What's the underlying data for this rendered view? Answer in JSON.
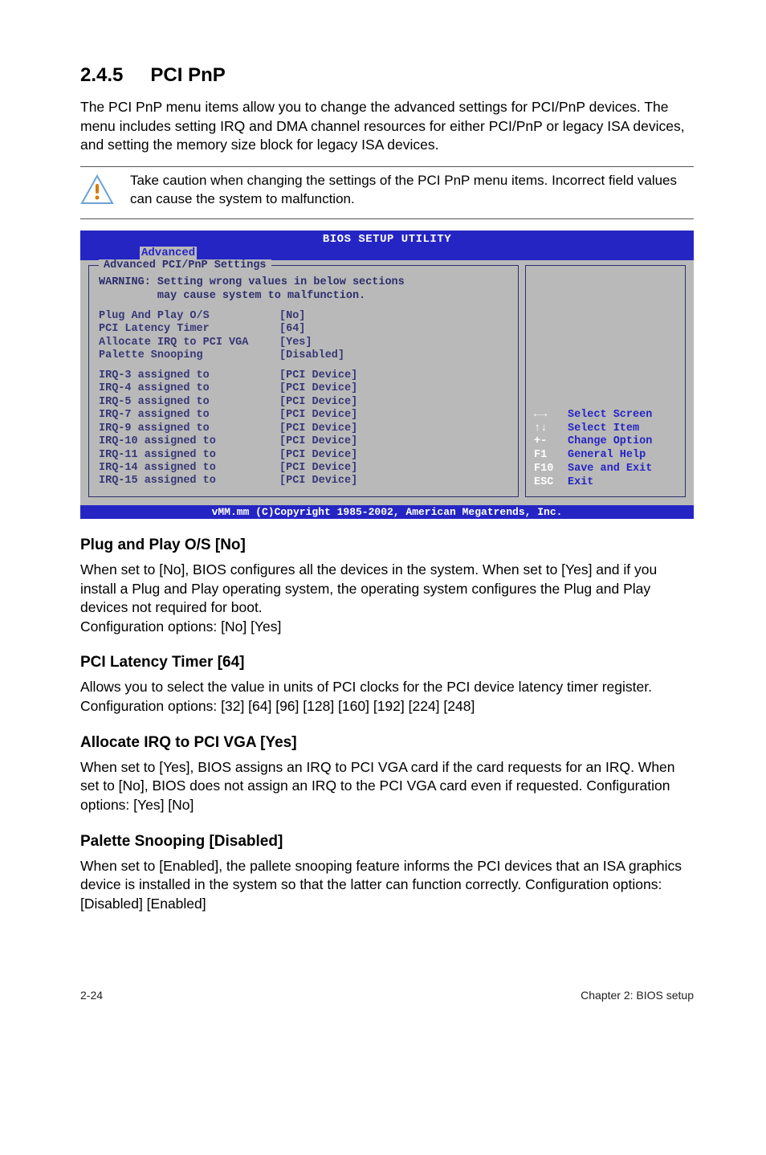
{
  "header": {
    "section_number": "2.4.5",
    "section_title": "PCI PnP"
  },
  "intro": "The PCI PnP menu items allow you to change the advanced settings for PCI/PnP devices. The menu includes setting IRQ and DMA channel resources for either PCI/PnP or legacy ISA devices, and setting the memory size block for legacy ISA devices.",
  "caution_note": "Take caution when changing the settings of the PCI PnP menu items. Incorrect field values can cause the system to malfunction.",
  "bios": {
    "util_title": "BIOS SETUP UTILITY",
    "tab": "Advanced",
    "panel_title": "Advanced PCI/PnP Settings",
    "warning_line1": "WARNING: Setting wrong values in below sections",
    "warning_line2": "         may cause system to malfunction.",
    "group1": [
      {
        "k": "Plug And Play O/S",
        "v": "[No]"
      },
      {
        "k": "PCI Latency Timer",
        "v": "[64]"
      },
      {
        "k": "Allocate IRQ to PCI VGA",
        "v": "[Yes]"
      },
      {
        "k": "Palette Snooping",
        "v": "[Disabled]"
      }
    ],
    "group2": [
      {
        "k": "IRQ-3 assigned to",
        "v": "[PCI Device]"
      },
      {
        "k": "IRQ-4 assigned to",
        "v": "[PCI Device]"
      },
      {
        "k": "IRQ-5 assigned to",
        "v": "[PCI Device]"
      },
      {
        "k": "IRQ-7 assigned to",
        "v": "[PCI Device]"
      },
      {
        "k": "IRQ-9 assigned to",
        "v": "[PCI Device]"
      },
      {
        "k": "IRQ-10 assigned to",
        "v": "[PCI Device]"
      },
      {
        "k": "IRQ-11 assigned to",
        "v": "[PCI Device]"
      },
      {
        "k": "IRQ-14 assigned to",
        "v": "[PCI Device]"
      },
      {
        "k": "IRQ-15 assigned to",
        "v": "[PCI Device]"
      }
    ],
    "help": [
      {
        "key": "←→",
        "label": "Select Screen"
      },
      {
        "key": "↑↓",
        "label": "Select Item"
      },
      {
        "key": "+-",
        "label": "Change Option"
      },
      {
        "key": "F1",
        "label": "General Help"
      },
      {
        "key": "F10",
        "label": "Save and Exit"
      },
      {
        "key": "ESC",
        "label": "Exit"
      }
    ],
    "copyright": "vMM.mm (C)Copyright 1985-2002, American Megatrends, Inc."
  },
  "sections": [
    {
      "title": "Plug and Play O/S [No]",
      "body": "When set to [No], BIOS configures all the devices in the system. When set to [Yes] and if you install a Plug and Play operating system, the operating system configures the Plug and Play devices not required for boot.\nConfiguration options: [No] [Yes]"
    },
    {
      "title": "PCI Latency Timer [64]",
      "body": "Allows you to select the value in units of PCI clocks for the PCI device latency timer register. Configuration options: [32] [64] [96] [128] [160] [192] [224] [248]"
    },
    {
      "title": "Allocate IRQ to PCI VGA [Yes]",
      "body": "When set to [Yes], BIOS assigns an IRQ to PCI VGA card if the card requests for an IRQ. When set to [No], BIOS does not assign an IRQ to the PCI VGA card even if requested. Configuration options: [Yes] [No]"
    },
    {
      "title": "Palette Snooping [Disabled]",
      "body": "When set to [Enabled], the pallete snooping feature informs the PCI devices that an ISA graphics device is installed in the system so that the latter can function correctly. Configuration options: [Disabled] [Enabled]"
    }
  ],
  "footer": {
    "left": "2-24",
    "right": "Chapter 2: BIOS setup"
  }
}
